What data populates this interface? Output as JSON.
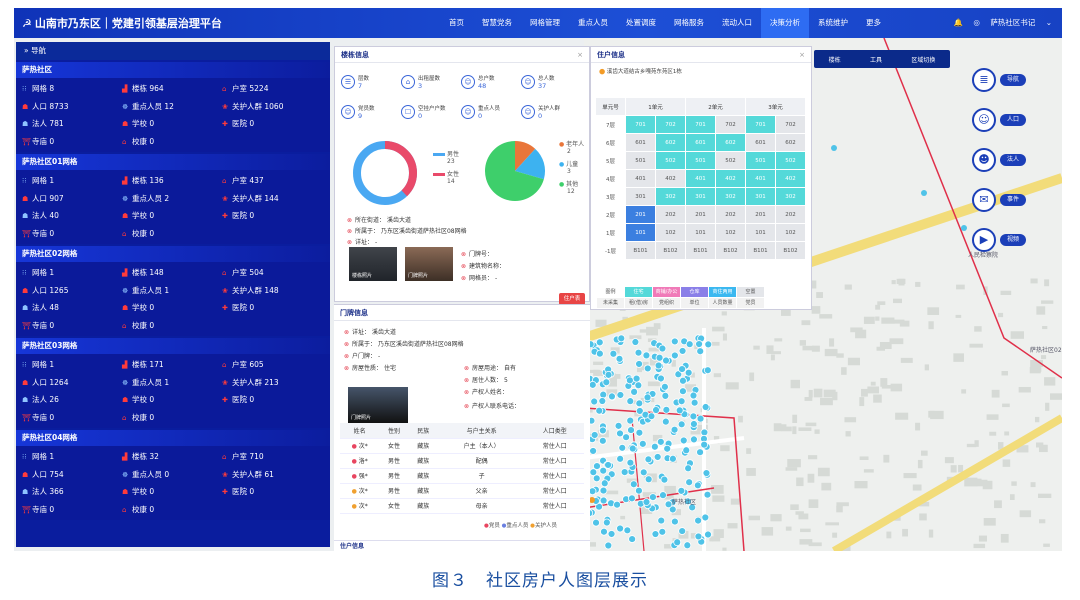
{
  "topbar": {
    "title": "山南市乃东区｜党建引领基层治理平台",
    "nav": [
      "首页",
      "智慧党务",
      "网格管理",
      "重点人员",
      "处置调度",
      "网格服务",
      "流动人口",
      "决策分析",
      "系统维护",
      "更多"
    ],
    "active_nav": 7,
    "user": "萨热社区书记"
  },
  "navpanel": {
    "title": "导航",
    "cells": [
      {
        "name": "萨热社区",
        "items": [
          [
            "网格",
            "8"
          ],
          [
            "楼栋",
            "964"
          ],
          [
            "户室",
            "5224"
          ],
          [
            "人口",
            "8733"
          ],
          [
            "重点人员",
            "12"
          ],
          [
            "关护人群",
            "1060"
          ],
          [
            "法人",
            "781"
          ],
          [
            "学校",
            "0"
          ],
          [
            "医院",
            "0"
          ],
          [
            "寺庙",
            "0"
          ],
          [
            "校康",
            "0"
          ]
        ]
      },
      {
        "name": "萨热社区01网格",
        "items": [
          [
            "网格",
            "1"
          ],
          [
            "楼栋",
            "136"
          ],
          [
            "户室",
            "437"
          ],
          [
            "人口",
            "907"
          ],
          [
            "重点人员",
            "2"
          ],
          [
            "关护人群",
            "144"
          ],
          [
            "法人",
            "40"
          ],
          [
            "学校",
            "0"
          ],
          [
            "医院",
            "0"
          ],
          [
            "寺庙",
            "0"
          ],
          [
            "校康",
            "0"
          ]
        ]
      },
      {
        "name": "萨热社区02网格",
        "items": [
          [
            "网格",
            "1"
          ],
          [
            "楼栋",
            "148"
          ],
          [
            "户室",
            "504"
          ],
          [
            "人口",
            "1265"
          ],
          [
            "重点人员",
            "1"
          ],
          [
            "关护人群",
            "148"
          ],
          [
            "法人",
            "48"
          ],
          [
            "学校",
            "0"
          ],
          [
            "医院",
            "0"
          ],
          [
            "寺庙",
            "0"
          ],
          [
            "校康",
            "0"
          ]
        ]
      },
      {
        "name": "萨热社区03网格",
        "items": [
          [
            "网格",
            "1"
          ],
          [
            "楼栋",
            "171"
          ],
          [
            "户室",
            "605"
          ],
          [
            "人口",
            "1264"
          ],
          [
            "重点人员",
            "1"
          ],
          [
            "关护人群",
            "213"
          ],
          [
            "法人",
            "26"
          ],
          [
            "学校",
            "0"
          ],
          [
            "医院",
            "0"
          ],
          [
            "寺庙",
            "0"
          ],
          [
            "校康",
            "0"
          ]
        ]
      },
      {
        "name": "萨热社区04网格",
        "items": [
          [
            "网格",
            "1"
          ],
          [
            "楼栋",
            "32"
          ],
          [
            "户室",
            "710"
          ],
          [
            "人口",
            "754"
          ],
          [
            "重点人员",
            "0"
          ],
          [
            "关护人群",
            "61"
          ],
          [
            "法人",
            "366"
          ],
          [
            "学校",
            "0"
          ],
          [
            "医院",
            "0"
          ],
          [
            "寺庙",
            "0"
          ],
          [
            "校康",
            "0"
          ]
        ]
      }
    ]
  },
  "gridinfo": {
    "title": "楼栋信息",
    "stats": [
      [
        "层数",
        "7"
      ],
      [
        "出租屋数",
        "3"
      ],
      [
        "总户数",
        "48"
      ],
      [
        "总人数",
        "37"
      ],
      [
        "党员数",
        "9"
      ],
      [
        "空挂户户数",
        "0"
      ],
      [
        "重点人员",
        "0"
      ],
      [
        "关护人群",
        "0"
      ]
    ],
    "gender": {
      "male_label": "男性",
      "male": "23",
      "female_label": "女性",
      "female": "14"
    },
    "age": [
      {
        "label": "老年人",
        "value": 2,
        "color": "#e9763a"
      },
      {
        "label": "儿童",
        "value": 3,
        "color": "#3db2f0"
      },
      {
        "label": "其他",
        "value": 12,
        "color": "#3ecf6b"
      }
    ],
    "info": [
      "所在街道：  溪齿大道",
      "所属于：  乃东区溪齿街道萨热社区08网格",
      "详址：  -"
    ],
    "photos": [
      "楼栋照片",
      "门牌照片"
    ],
    "door_fields": [
      "门牌号：",
      "建筑物名称：",
      "网格员：  -"
    ],
    "btn": "住户表"
  },
  "doorinfo": {
    "title": "门牌信息",
    "fields": [
      "详址：  溪齿大道",
      "所属于：  乃东区溪齿街道萨热社区08网格",
      "户门牌：  -",
      "房屋性质：  住宅",
      "房屋用途：  自有",
      "居住人数：  5",
      "产权人姓名：",
      "产权人联系电话："
    ],
    "photo": "门牌照片",
    "cols": [
      "姓名",
      "性别",
      "民族",
      "与户主关系",
      "人口类型"
    ],
    "rows": [
      [
        "次*",
        "女性",
        "藏族",
        "户主（本人）",
        "常住人口"
      ],
      [
        "洛*",
        "男性",
        "藏族",
        "配偶",
        "常住人口"
      ],
      [
        "强*",
        "男性",
        "藏族",
        "子",
        "常住人口"
      ],
      [
        "次*",
        "男性",
        "藏族",
        "父亲",
        "常住人口"
      ],
      [
        "次*",
        "女性",
        "藏族",
        "母亲",
        "常住人口"
      ]
    ],
    "legend": [
      "党员",
      "重点人员",
      "关护人员"
    ],
    "foot": "住户信息"
  },
  "household": {
    "title": "住户信息",
    "addr": "溪齿大道结古乡嘎苑东苑区1栋",
    "units": [
      "单元号",
      "1单元",
      "2单元",
      "3单元"
    ],
    "floors": [
      {
        "f": "7层",
        "c": [
          "701",
          "702",
          "701",
          "702",
          "701",
          "702"
        ],
        "on": [
          1,
          1,
          1,
          0,
          1,
          0
        ]
      },
      {
        "f": "6层",
        "c": [
          "601",
          "602",
          "601",
          "602",
          "601",
          "602"
        ],
        "on": [
          0,
          1,
          1,
          1,
          0,
          0
        ]
      },
      {
        "f": "5层",
        "c": [
          "501",
          "502",
          "501",
          "502",
          "501",
          "502"
        ],
        "on": [
          0,
          1,
          1,
          0,
          1,
          1
        ]
      },
      {
        "f": "4层",
        "c": [
          "401",
          "402",
          "401",
          "402",
          "401",
          "402"
        ],
        "on": [
          0,
          0,
          1,
          1,
          1,
          1
        ]
      },
      {
        "f": "3层",
        "c": [
          "301",
          "302",
          "301",
          "302",
          "301",
          "302"
        ],
        "on": [
          0,
          1,
          1,
          1,
          1,
          1
        ]
      },
      {
        "f": "2层",
        "c": [
          "201",
          "202",
          "201",
          "202",
          "201",
          "202"
        ],
        "on": [
          2,
          0,
          0,
          0,
          0,
          0
        ]
      },
      {
        "f": "1层",
        "c": [
          "101",
          "102",
          "101",
          "102",
          "101",
          "102"
        ],
        "on": [
          2,
          0,
          0,
          0,
          0,
          0
        ]
      },
      {
        "f": "-1层",
        "c": [
          "B101",
          "B102",
          "B101",
          "B102",
          "B101",
          "B102"
        ],
        "on": [
          0,
          0,
          0,
          0,
          0,
          0
        ]
      }
    ],
    "types": [
      "图例",
      "住宅",
      "商铺/办公",
      "仓库",
      "商住两用",
      "空置"
    ],
    "types2": [
      "未采集",
      "租(借)房",
      "党组织",
      "单位",
      "人员数量",
      "党员"
    ]
  },
  "maptool": [
    "楼栋",
    "工具",
    "区域切换"
  ],
  "side": [
    [
      "导航",
      "≣"
    ],
    [
      "人口",
      "☺"
    ],
    [
      "法人",
      "☻"
    ],
    [
      "事件",
      "✉"
    ],
    [
      "视频",
      "▶"
    ]
  ],
  "maplabels": [
    "萨热社区",
    "人民检察院",
    "萨热社区02"
  ],
  "caption": "图３　社区房户人图层展示"
}
